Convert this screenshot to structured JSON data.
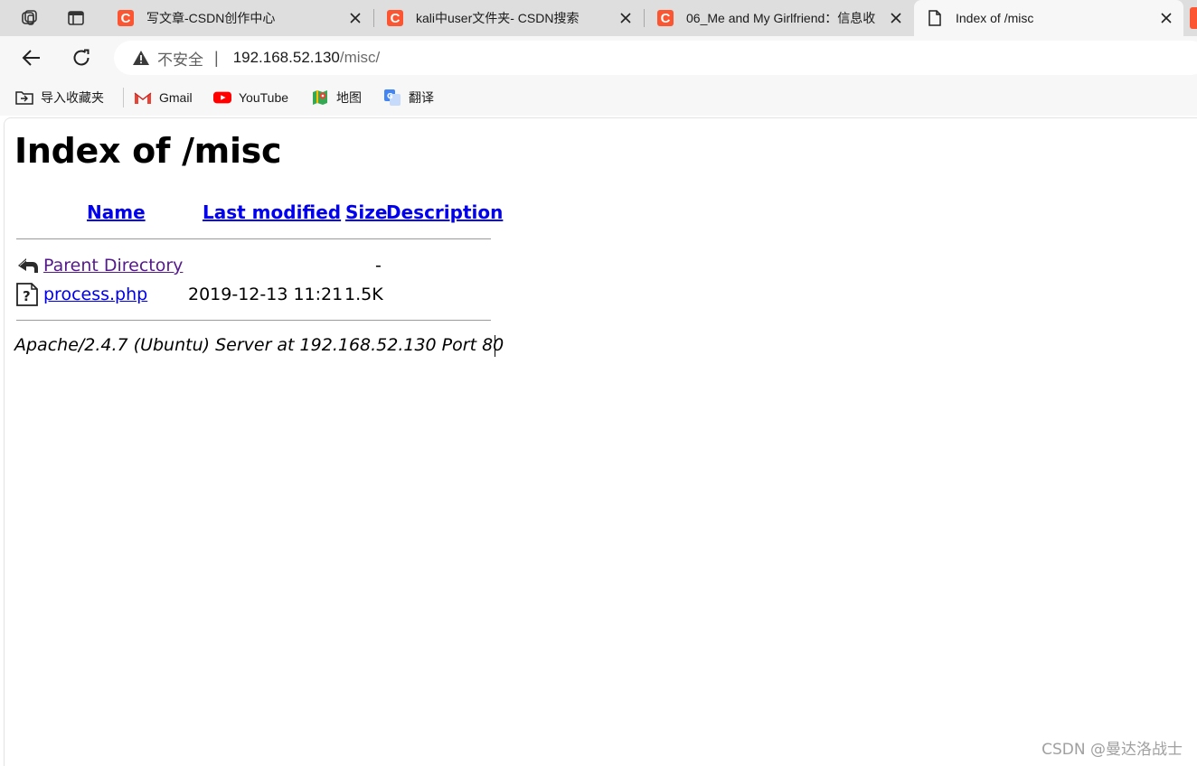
{
  "tabs": [
    {
      "title": "写文章-CSDN创作中心",
      "favicon": "csdn-icon",
      "active": false
    },
    {
      "title": "kali中user文件夹- CSDN搜索",
      "favicon": "csdn-icon",
      "active": false
    },
    {
      "title": "06_Me and My Girlfriend：信息收",
      "favicon": "csdn-icon",
      "active": false
    },
    {
      "title": "Index of /misc",
      "favicon": "page-icon",
      "active": true
    }
  ],
  "omnibox": {
    "security_label": "不安全",
    "separator": "|",
    "url_host": "192.168.52.130",
    "url_path": "/misc/"
  },
  "bookmarks": [
    {
      "label": "导入收藏夹",
      "icon": "import-bookmarks-icon"
    },
    {
      "label": "Gmail",
      "icon": "gmail-icon"
    },
    {
      "label": "YouTube",
      "icon": "youtube-icon"
    },
    {
      "label": "地图",
      "icon": "maps-icon"
    },
    {
      "label": "翻译",
      "icon": "translate-icon"
    }
  ],
  "page": {
    "heading": "Index of /misc",
    "columns": {
      "name": "Name",
      "last_modified": "Last modified",
      "size": "Size",
      "description": "Description"
    },
    "rows": [
      {
        "name": "Parent Directory",
        "modified": "",
        "size": "-",
        "icon": "back-arrow-icon"
      },
      {
        "name": "process.php",
        "modified": "2019-12-13 11:21",
        "size": "1.5K",
        "icon": "unknown-file-icon"
      }
    ],
    "server_signature": "Apache/2.4.7 (Ubuntu) Server at 192.168.52.130 Port 80"
  },
  "watermark": "CSDN @曼达洛战士",
  "colors": {
    "link": "#0000ee",
    "visited_link": "#551a8b",
    "csdn_brand": "#fc5531"
  }
}
